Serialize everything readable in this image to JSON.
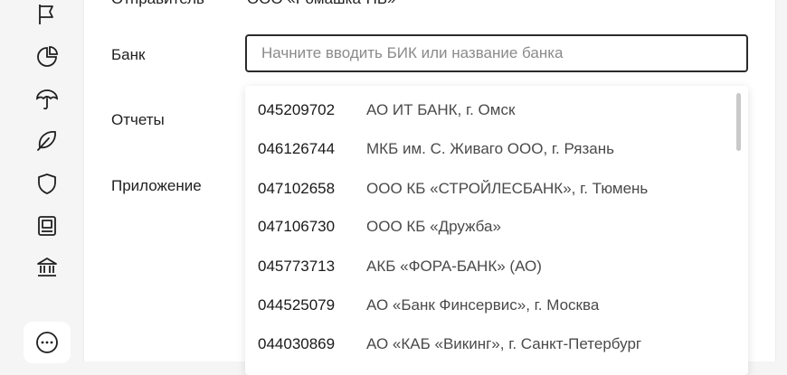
{
  "sender": {
    "label": "Отправитель",
    "value": "ООО «Ромашка-НБ»"
  },
  "bank": {
    "label": "Банк",
    "placeholder": "Начните вводить БИК или название банка"
  },
  "reports": {
    "label": "Отчеты"
  },
  "application": {
    "label": "Приложение"
  },
  "options": [
    {
      "bic": "045209702",
      "name": "АО ИТ БАНК, г. Омск"
    },
    {
      "bic": "046126744",
      "name": "МКБ им. С. Живаго ООО, г. Рязань"
    },
    {
      "bic": "047102658",
      "name": "ООО КБ «СТРОЙЛЕСБАНК», г. Тюмень"
    },
    {
      "bic": "047106730",
      "name": "ООО КБ «Дружба»"
    },
    {
      "bic": "045773713",
      "name": "АКБ «ФОРА-БАНК» (АО)"
    },
    {
      "bic": "044525079",
      "name": "АО «Банк Финсервис», г. Москва"
    },
    {
      "bic": "044030869",
      "name": "АО «КАБ «Викинг», г. Санкт-Петербург"
    }
  ],
  "sidebar": {
    "icons": [
      "flag-icon",
      "pie-chart-icon",
      "umbrella-icon",
      "leaf-icon",
      "shield-icon",
      "wallet-icon",
      "bank-icon",
      "more-icon"
    ],
    "active": "more-icon"
  }
}
